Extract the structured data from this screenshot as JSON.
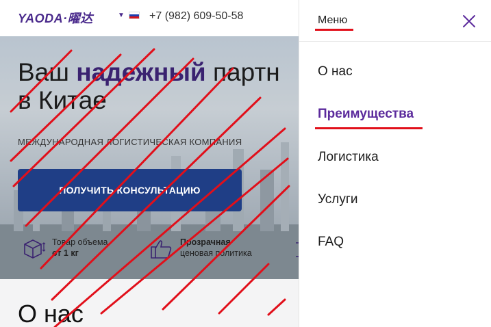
{
  "header": {
    "logo": "YAODA·曜达",
    "phone": "+7 (982) 609-50-58",
    "language_icon": "chevron-down-icon",
    "flag": "russia-flag-icon"
  },
  "hero": {
    "title_before": "Ваш ",
    "title_highlight": "надежный",
    "title_after": " партн",
    "title_line2": "в Китае",
    "tagline": "МЕЖДУНАРОДНАЯ ЛОГИСТИЧЕСКАЯ КОМПАНИЯ",
    "cta": "ПОЛУЧИТЬ КОНСУЛЬТАЦИЮ",
    "features": [
      {
        "line1": "Товар объема",
        "line2": "от 1 кг",
        "icon": "box-icon"
      },
      {
        "line1": "Прозрачная",
        "line2": "ценовая политика",
        "icon": "thumbs-up-icon"
      }
    ]
  },
  "about": {
    "title": "О нас"
  },
  "menu": {
    "title": "Меню",
    "close_icon": "close-icon",
    "items": [
      "О нас",
      "Преимущества",
      "Логистика",
      "Услуги",
      "FAQ"
    ],
    "active_index": 1
  },
  "colors": {
    "brand": "#4a2a8c",
    "cta": "#1f3e86",
    "accent_red": "#e10f1a",
    "menu_active": "#5b2a9c"
  }
}
